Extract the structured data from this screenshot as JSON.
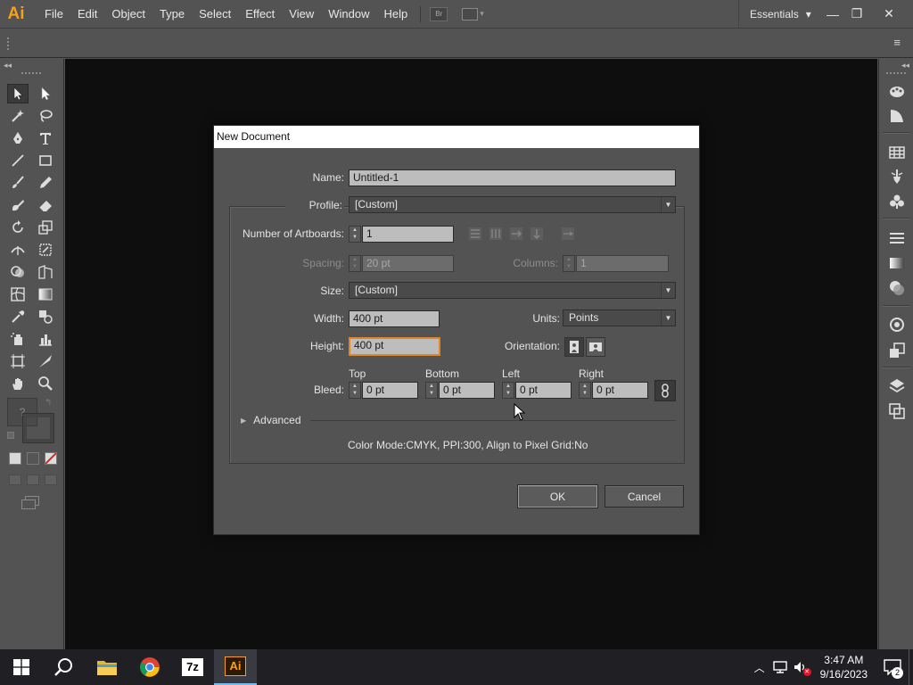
{
  "app": {
    "logo": "Ai",
    "menu": [
      "File",
      "Edit",
      "Object",
      "Type",
      "Select",
      "Effect",
      "View",
      "Window",
      "Help"
    ],
    "bridge_label": "Br",
    "workspace": "Essentials",
    "workspace_caret": "▾",
    "window_controls": {
      "minimize": "—",
      "restore": "❐",
      "close": "✕"
    },
    "controlbar_menu_icon": "≡"
  },
  "dialog": {
    "title": "New Document",
    "name_label": "Name:",
    "name_value": "Untitled-1",
    "profile_label": "Profile:",
    "profile_value": "[Custom]",
    "artboards_label": "Number of Artboards:",
    "artboards_value": "1",
    "spacing_label": "Spacing:",
    "spacing_value": "20 pt",
    "columns_label": "Columns:",
    "columns_value": "1",
    "size_label": "Size:",
    "size_value": "[Custom]",
    "width_label": "Width:",
    "width_value": "400 pt",
    "units_label": "Units:",
    "units_value": "Points",
    "height_label": "Height:",
    "height_value": "400 pt",
    "orientation_label": "Orientation:",
    "bleed_label": "Bleed:",
    "bleed": {
      "top_label": "Top",
      "top_value": "0 pt",
      "bottom_label": "Bottom",
      "bottom_value": "0 pt",
      "left_label": "Left",
      "left_value": "0 pt",
      "right_label": "Right",
      "right_value": "0 pt"
    },
    "advanced_label": "Advanced",
    "summary": "Color Mode:CMYK, PPI:300, Align to Pixel Grid:No",
    "ok_label": "OK",
    "cancel_label": "Cancel"
  },
  "taskbar": {
    "time": "3:47 AM",
    "date": "9/16/2023",
    "notification_count": "2",
    "apps": [
      "start",
      "search",
      "file-explorer",
      "chrome",
      "7zip",
      "illustrator"
    ],
    "sevenzip_label": "7z",
    "ai_label": "Ai"
  },
  "colors": {
    "accent_orange": "#f7a01c",
    "panel_bg": "#535353",
    "canvas_bg": "#0e0e0e",
    "focus_border": "#e0862a"
  }
}
